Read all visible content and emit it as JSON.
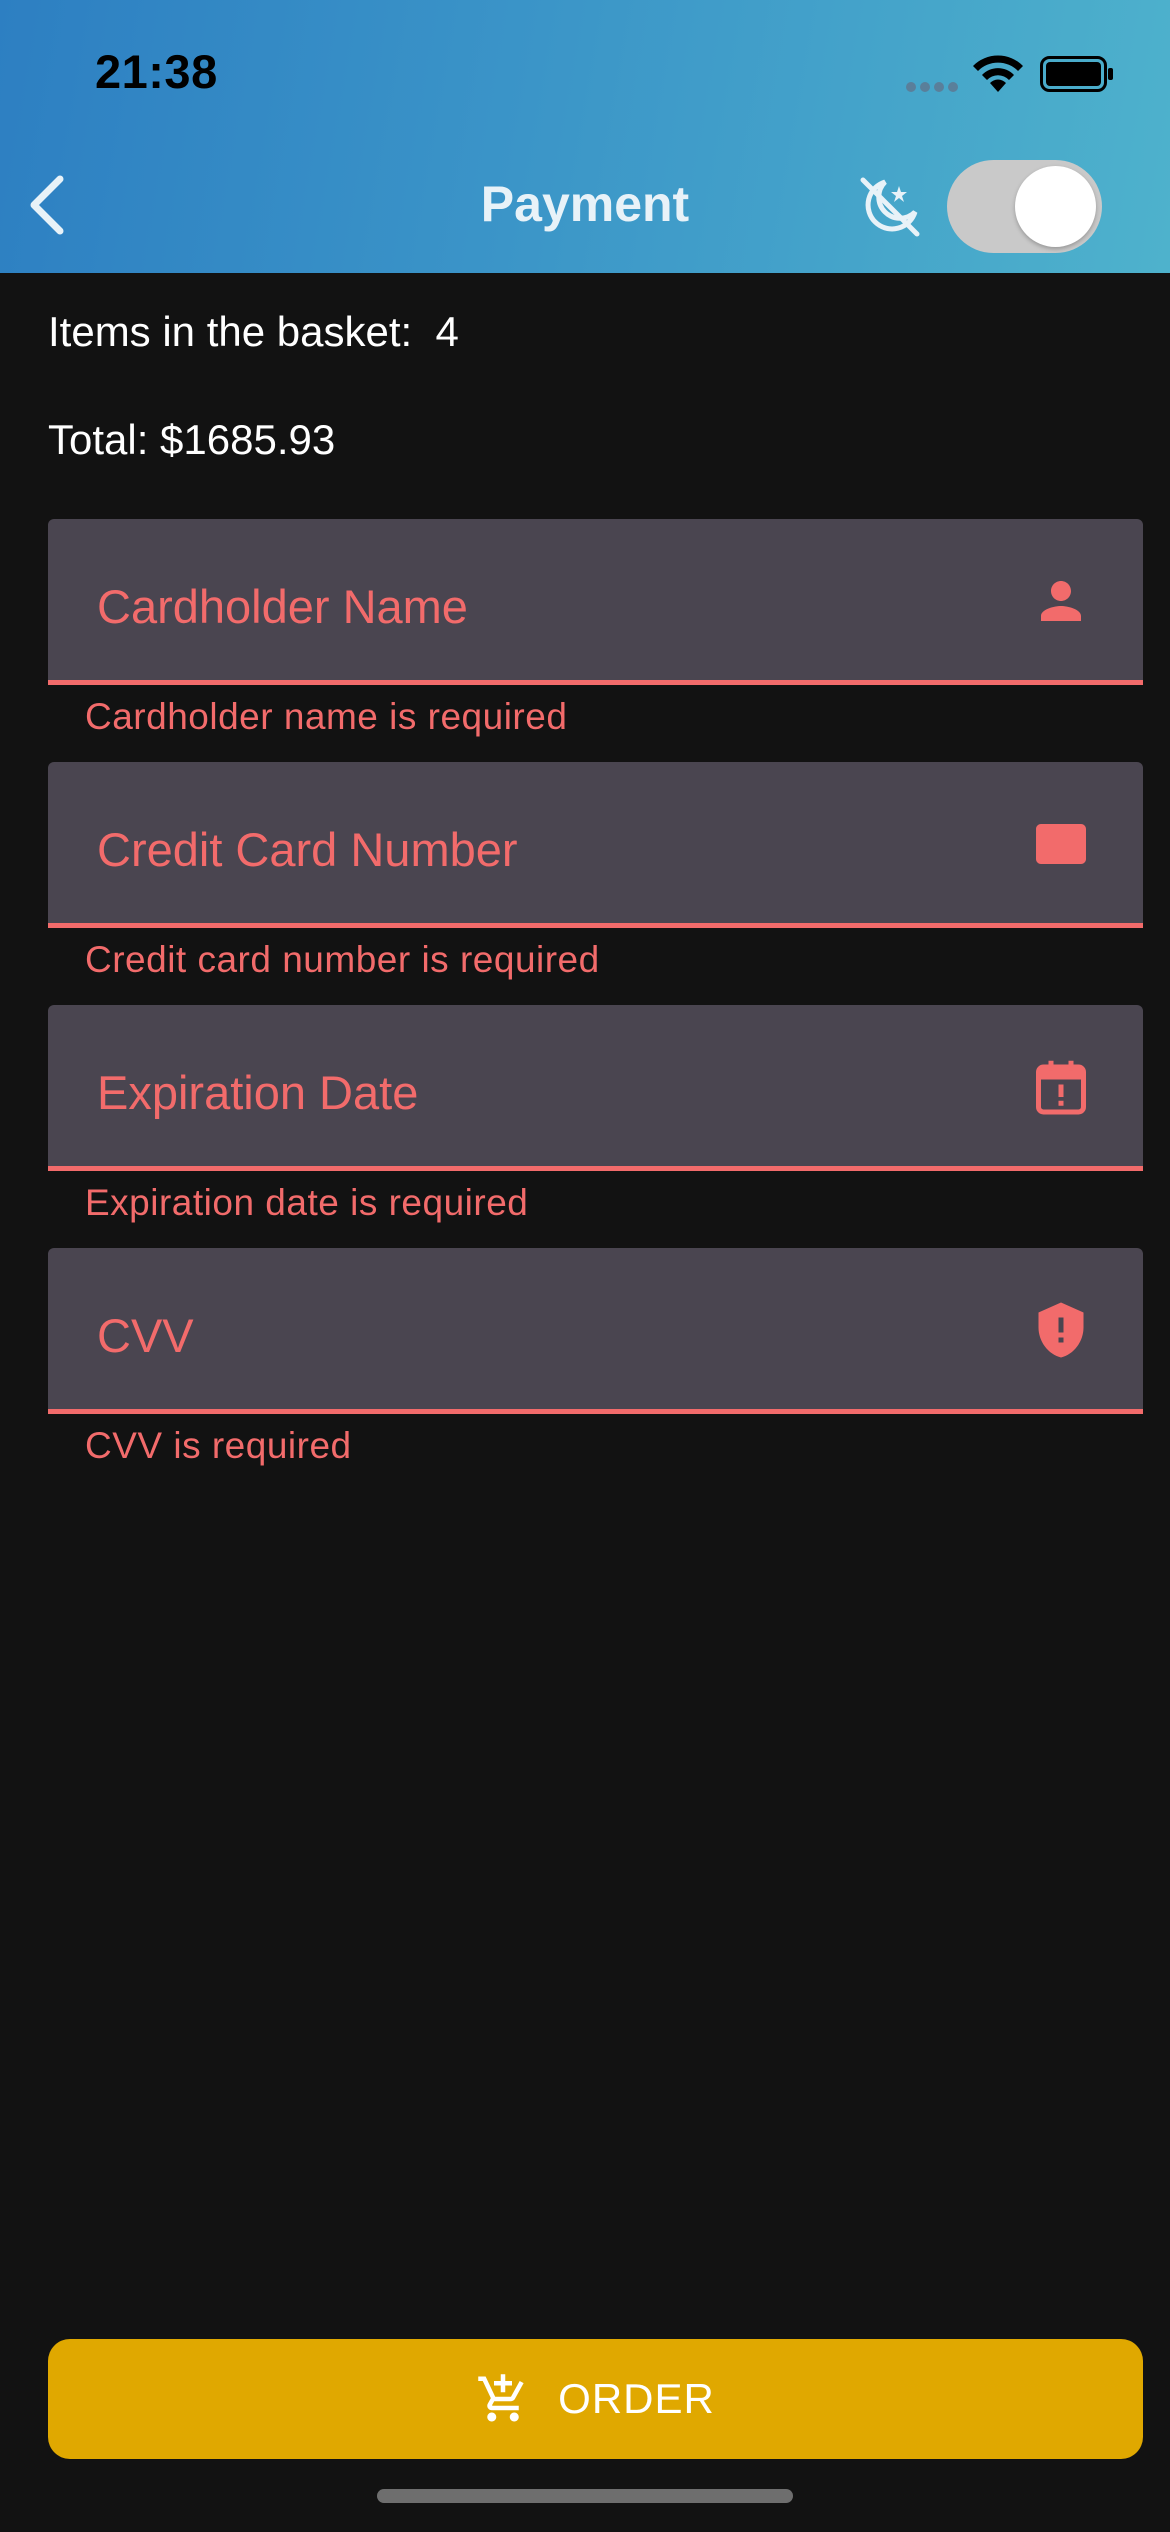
{
  "status_bar": {
    "time": "21:38"
  },
  "app_bar": {
    "title": "Payment",
    "theme_toggle_on": true
  },
  "summary": {
    "items_text": "Items in the basket:  4",
    "total_text": "Total: $1685.93"
  },
  "fields": [
    {
      "label": "Cardholder Name",
      "error": "Cardholder name is required",
      "icon": "person-icon"
    },
    {
      "label": "Credit Card Number",
      "error": "Credit card number is required",
      "icon": "credit-card-icon"
    },
    {
      "label": "Expiration Date",
      "error": "Expiration date is required",
      "icon": "calendar-alert-icon"
    },
    {
      "label": "CVV",
      "error": "CVV is required",
      "icon": "shield-alert-icon"
    }
  ],
  "order_button": {
    "label": "ORDER",
    "icon": "cart-add-icon"
  },
  "colors": {
    "header_gradient_start": "#2d7fc2",
    "header_gradient_end": "#4eb2cc",
    "background": "#121212",
    "field_background": "#4a4550",
    "error": "#f26b6b",
    "order_button": "#e0a800"
  }
}
